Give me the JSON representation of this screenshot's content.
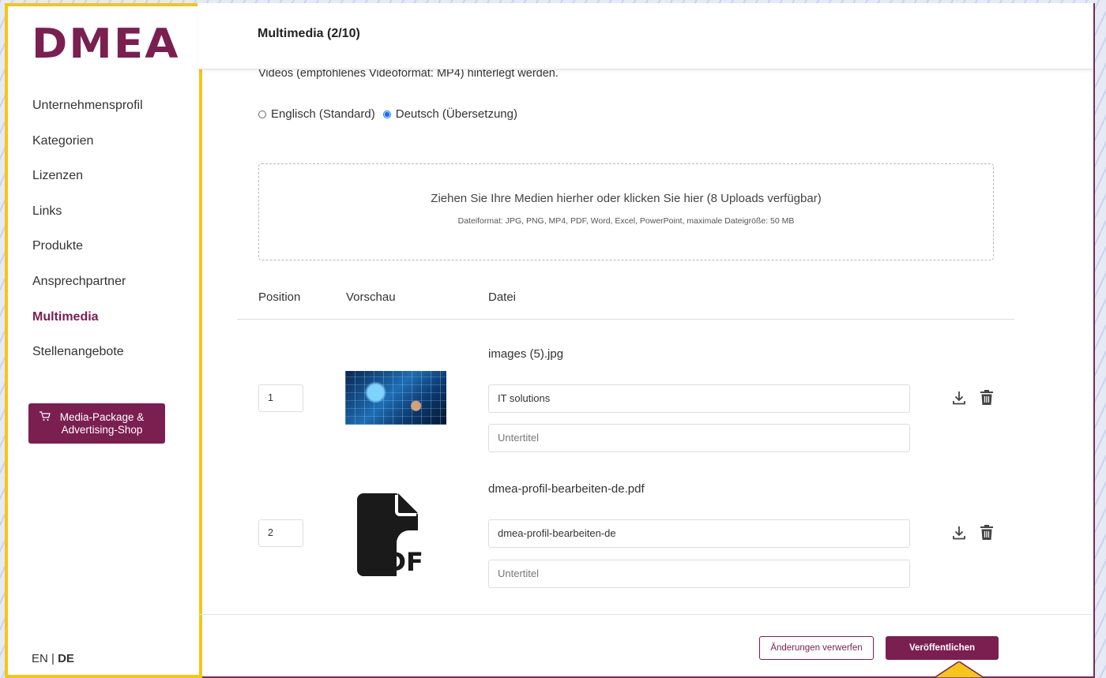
{
  "sidebar": {
    "logo": "DMEA",
    "items": [
      {
        "label": "Unternehmensprofil"
      },
      {
        "label": "Kategorien"
      },
      {
        "label": "Lizenzen"
      },
      {
        "label": "Links"
      },
      {
        "label": "Produkte"
      },
      {
        "label": "Ansprechpartner"
      },
      {
        "label": "Multimedia",
        "active": true
      },
      {
        "label": "Stellenangebote"
      }
    ],
    "shop_button": "Media-Package & Advertising-Shop",
    "lang_en": "EN",
    "lang_sep": "|",
    "lang_de": "DE"
  },
  "header": {
    "title": "Multimedia (2/10)"
  },
  "main": {
    "intro": "Videos (empfohlenes Videoformat: MP4) hinterlegt werden.",
    "lang_options": [
      {
        "label": "Englisch (Standard)",
        "checked": false
      },
      {
        "label": "Deutsch (Übersetzung)",
        "checked": true
      }
    ],
    "dropzone": {
      "title": "Ziehen Sie Ihre Medien hierher oder klicken Sie hier (8 Uploads verfügbar)",
      "subtitle": "Dateiformat: JPG, PNG, MP4, PDF, Word, Excel, PowerPoint, maximale Dateigröße: 50 MB"
    },
    "table": {
      "headers": [
        "Position",
        "Vorschau",
        "Datei"
      ],
      "rows": [
        {
          "position": "1",
          "preview_type": "image",
          "filename": "images (5).jpg",
          "title": "IT solutions",
          "subtitle_placeholder": "Untertitel"
        },
        {
          "position": "2",
          "preview_type": "pdf-file-icon",
          "filename": "dmea-profil-bearbeiten-de.pdf",
          "title": "dmea-profil-bearbeiten-de",
          "subtitle_placeholder": "Untertitel"
        }
      ]
    }
  },
  "footer": {
    "discard_label": "Änderungen verwerfen",
    "publish_label": "Veröffentlichen"
  },
  "colors": {
    "brand": "#7a1f50",
    "highlight_border": "#f5c518",
    "radio_checked": "#1a73e8"
  }
}
